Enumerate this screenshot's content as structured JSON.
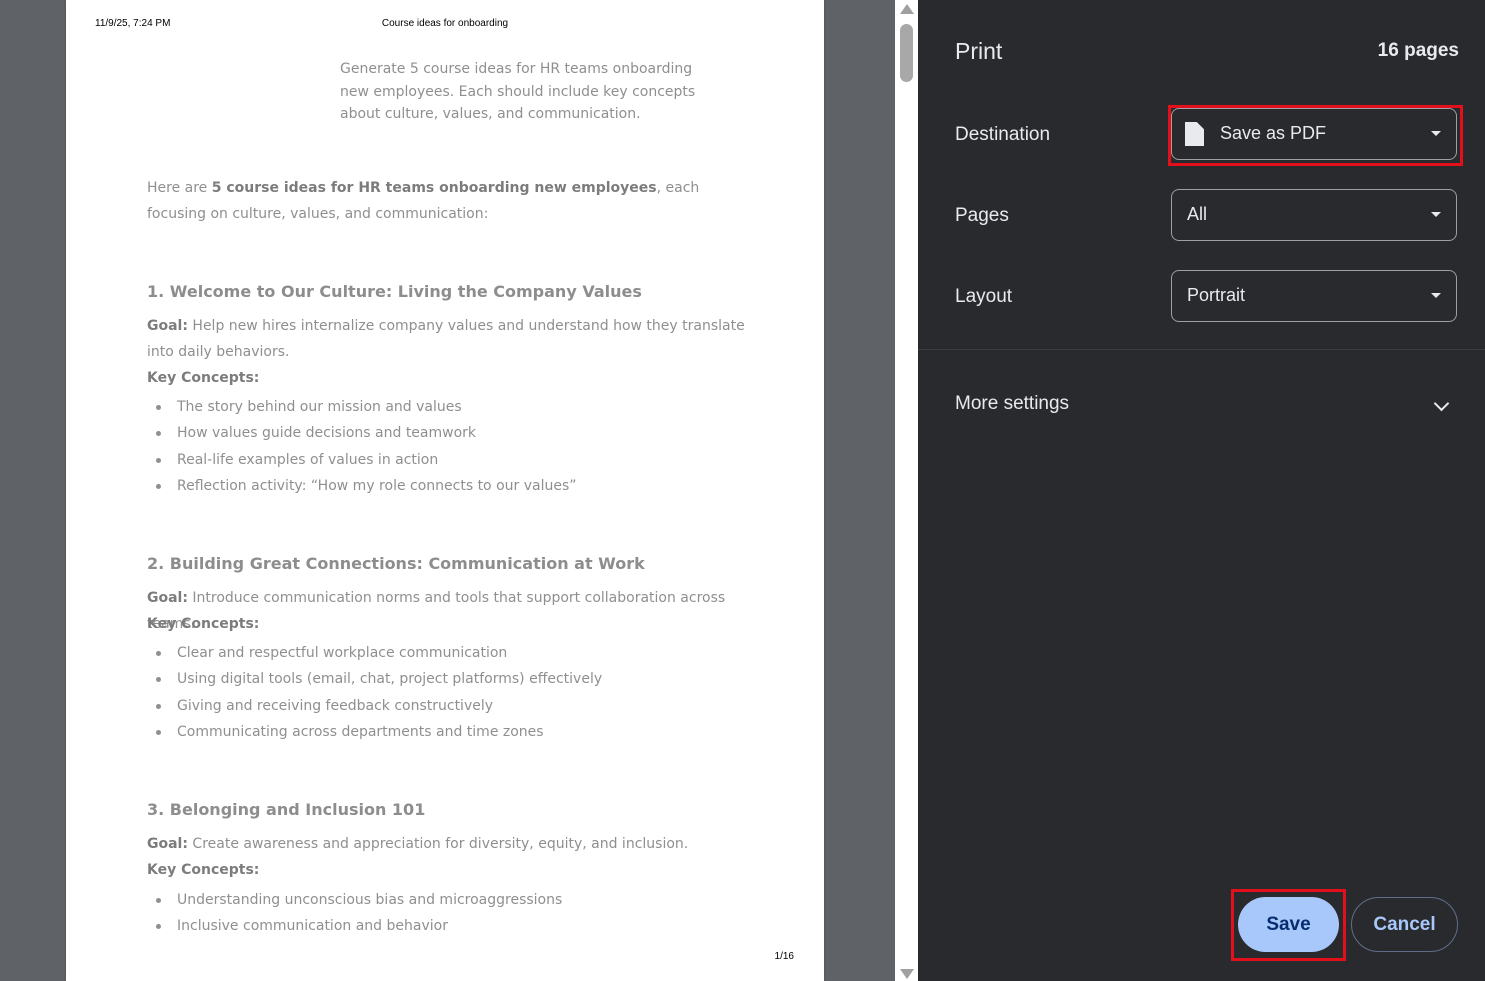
{
  "preview": {
    "header_date": "11/9/25, 7:24 PM",
    "header_title": "Course ideas for onboarding",
    "page_number": "1/16",
    "prompt": "Generate 5 course ideas for HR teams onboarding new employees. Each should include key concepts about culture, values, and communication.",
    "intro_prefix": "Here are ",
    "intro_bold": "5 course ideas for HR teams onboarding new employees",
    "intro_suffix": ", each focusing on culture, values, and communication:",
    "goal_label": "Goal:",
    "key_concepts_label": "Key Concepts:",
    "sections": [
      {
        "heading": "1. Welcome to Our Culture: Living the Company Values",
        "goal": " Help new hires internalize company values and understand how they translate into daily behaviors.",
        "concepts": [
          "The story behind our mission and values",
          "How values guide decisions and teamwork",
          "Real-life examples of values in action",
          "Reflection activity: “How my role connects to our values”"
        ]
      },
      {
        "heading": "2. Building Great Connections: Communication at Work",
        "goal": " Introduce communication norms and tools that support collaboration across teams.",
        "concepts": [
          "Clear and respectful workplace communication",
          "Using digital tools (email, chat, project platforms) effectively",
          "Giving and receiving feedback constructively",
          "Communicating across departments and time zones"
        ]
      },
      {
        "heading": "3. Belonging and Inclusion 101",
        "goal": " Create awareness and appreciation for diversity, equity, and inclusion.",
        "concepts": [
          "Understanding unconscious bias and microaggressions",
          "Inclusive communication and behavior"
        ]
      }
    ]
  },
  "print_panel": {
    "title": "Print",
    "page_count": "16 pages",
    "destination_label": "Destination",
    "destination_value": "Save as PDF",
    "pages_label": "Pages",
    "pages_value": "All",
    "layout_label": "Layout",
    "layout_value": "Portrait",
    "more_settings_label": "More settings",
    "save_label": "Save",
    "cancel_label": "Cancel",
    "highlight_color": "#e3101c",
    "accent_color": "#a8c7fa"
  }
}
